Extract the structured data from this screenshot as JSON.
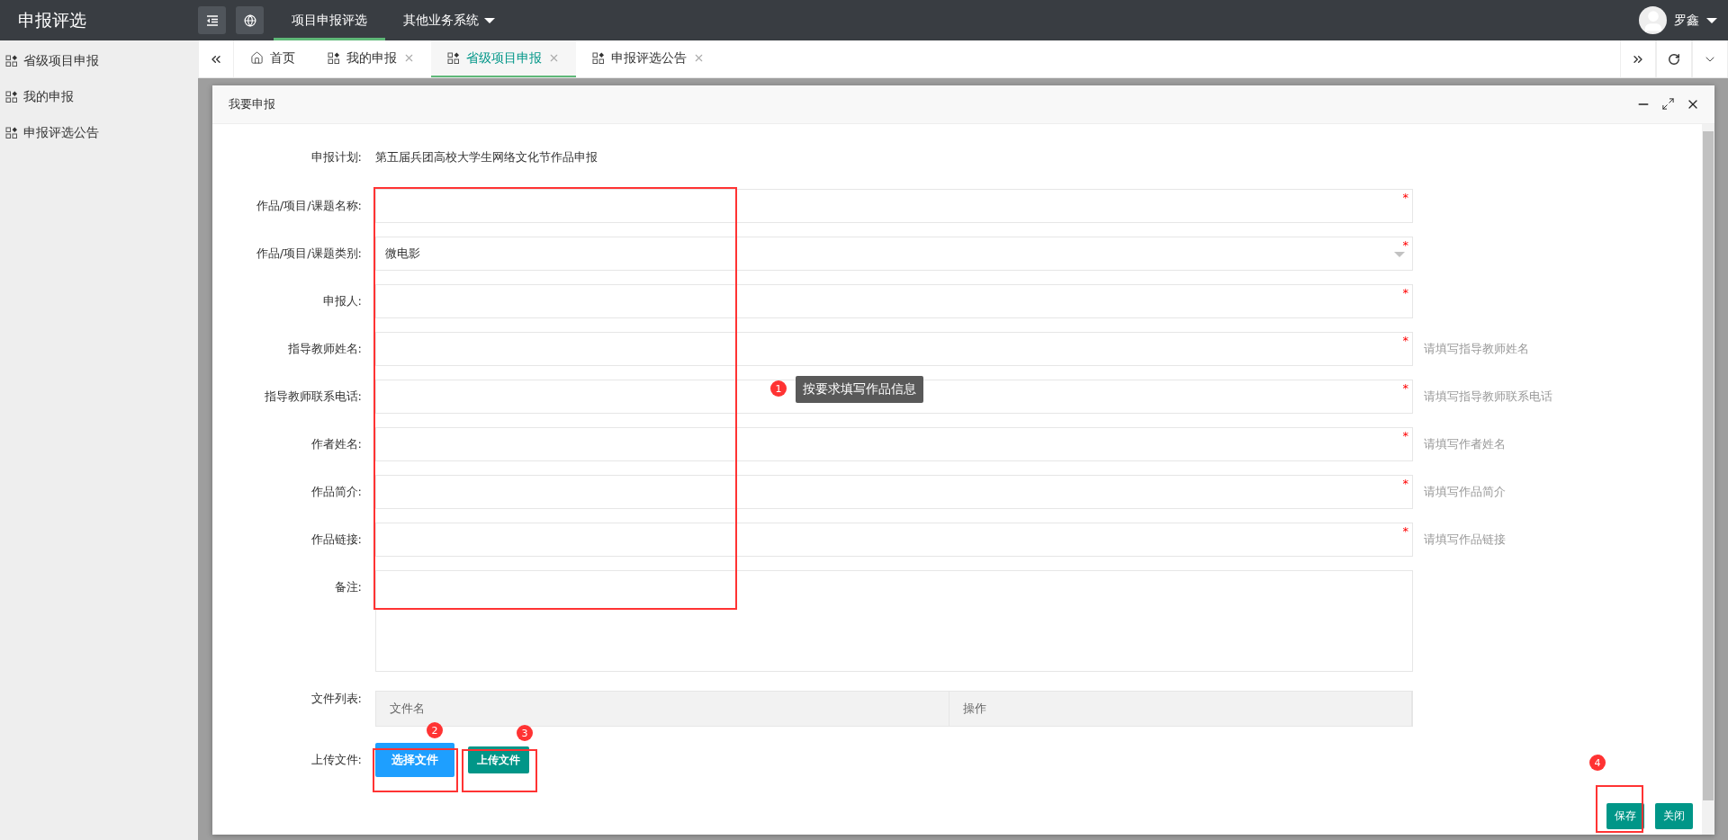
{
  "app_title": "申报评选",
  "top_nav": [
    {
      "label": "项目申报评选",
      "selected": true,
      "dropdown": false
    },
    {
      "label": "其他业务系统",
      "selected": false,
      "dropdown": true
    }
  ],
  "user": {
    "name": "罗鑫"
  },
  "sidebar": {
    "items": [
      {
        "label": "省级项目申报"
      },
      {
        "label": "我的申报"
      },
      {
        "label": "申报评选公告"
      }
    ]
  },
  "tabs": [
    {
      "label": "首页",
      "kind": "home",
      "closable": false,
      "selected": false
    },
    {
      "label": "我的申报",
      "kind": "page",
      "closable": true,
      "selected": false
    },
    {
      "label": "省级项目申报",
      "kind": "page",
      "closable": true,
      "selected": true
    },
    {
      "label": "申报评选公告",
      "kind": "page",
      "closable": true,
      "selected": false
    }
  ],
  "dialog": {
    "title": "我要申报",
    "plan": {
      "label": "申报计划:",
      "value": "第五届兵团高校大学生网络文化节作品申报"
    },
    "fields": [
      {
        "label": "作品/项目/课题名称:",
        "kind": "input",
        "required_mark": "*"
      },
      {
        "label": "作品/项目/课题类别:",
        "kind": "select",
        "value": "微电影",
        "required_mark": "*"
      },
      {
        "label": "申报人:",
        "kind": "input",
        "required_mark": "*"
      },
      {
        "label": "指导教师姓名:",
        "kind": "input",
        "required_mark": "*",
        "hint": "请填写指导教师姓名"
      },
      {
        "label": "指导教师联系电话:",
        "kind": "input",
        "required_mark": "*",
        "hint": "请填写指导教师联系电话"
      },
      {
        "label": "作者姓名:",
        "kind": "input",
        "required_mark": "*",
        "hint": "请填写作者姓名"
      },
      {
        "label": "作品简介:",
        "kind": "input",
        "required_mark": "*",
        "hint": "请填写作品简介"
      },
      {
        "label": "作品链接:",
        "kind": "input",
        "required_mark": "*",
        "hint": "请填写作品链接"
      },
      {
        "label": "备注:",
        "kind": "textarea"
      }
    ],
    "file_list": {
      "label": "文件列表:",
      "columns": [
        "文件名",
        "操作"
      ]
    },
    "upload": {
      "label": "上传文件:",
      "buttons": [
        {
          "label": "选择文件",
          "kind": "primary"
        },
        {
          "label": "上传文件",
          "kind": "secondary"
        }
      ]
    },
    "footer_buttons": [
      {
        "label": "保存"
      },
      {
        "label": "关闭"
      }
    ]
  },
  "annotations": {
    "tooltip": "按要求填写作品信息",
    "markers": [
      {
        "number": "1"
      },
      {
        "number": "2"
      },
      {
        "number": "3"
      },
      {
        "number": "4"
      }
    ]
  }
}
